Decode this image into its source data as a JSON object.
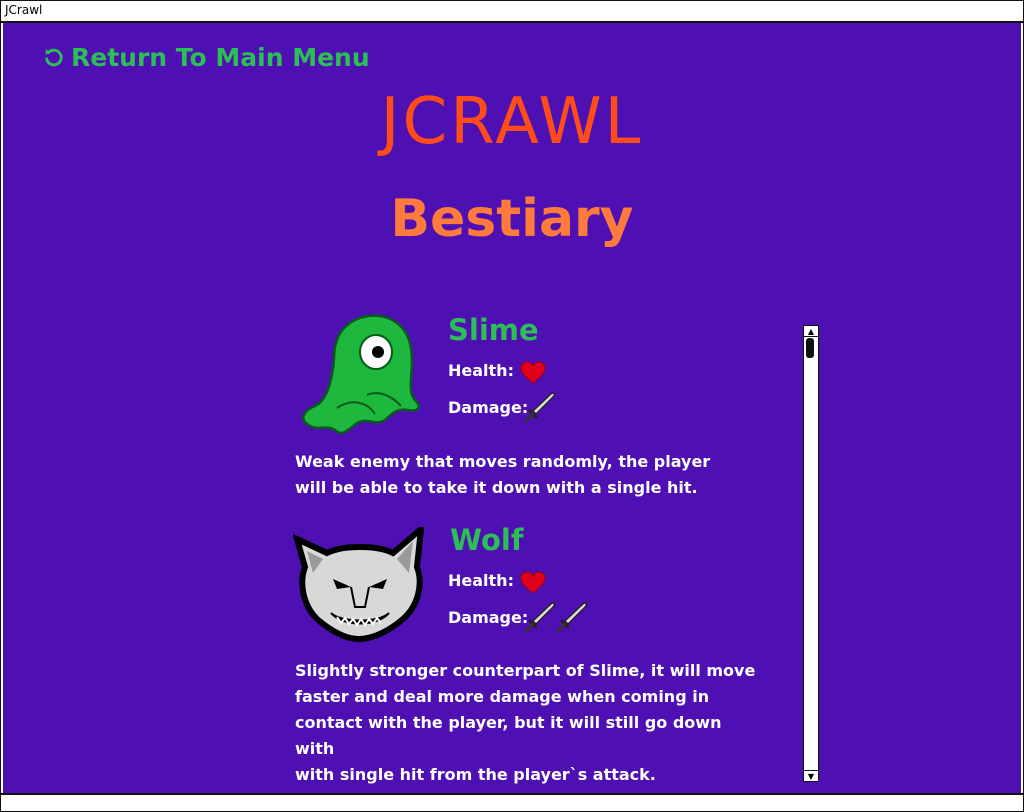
{
  "window": {
    "title": "JCrawl"
  },
  "nav": {
    "return_label": "Return To Main Menu"
  },
  "header": {
    "app_title": "JCRAWL",
    "page_title": "Bestiary"
  },
  "creatures": [
    {
      "name": "Slime",
      "health_label": "Health:",
      "damage_label": "Damage:",
      "health": 1,
      "damage": 1,
      "description_lines": [
        "Weak enemy that moves randomly, the player",
        "will be able to take it down with a single hit."
      ]
    },
    {
      "name": "Wolf",
      "health_label": "Health:",
      "damage_label": "Damage:",
      "health": 1,
      "damage": 2,
      "description_lines": [
        "Slightly stronger counterpart of Slime, it will move",
        "faster and deal more damage when coming in",
        "contact with the player, but it will still go down with",
        "with single hit from the player`s attack."
      ]
    }
  ],
  "colors": {
    "background": "#4e10b3",
    "accent_green": "#2bbf55",
    "title_orange": "#ff4d1a",
    "subtitle_orange": "#ff7a3d",
    "heart_red": "#e0001a"
  }
}
